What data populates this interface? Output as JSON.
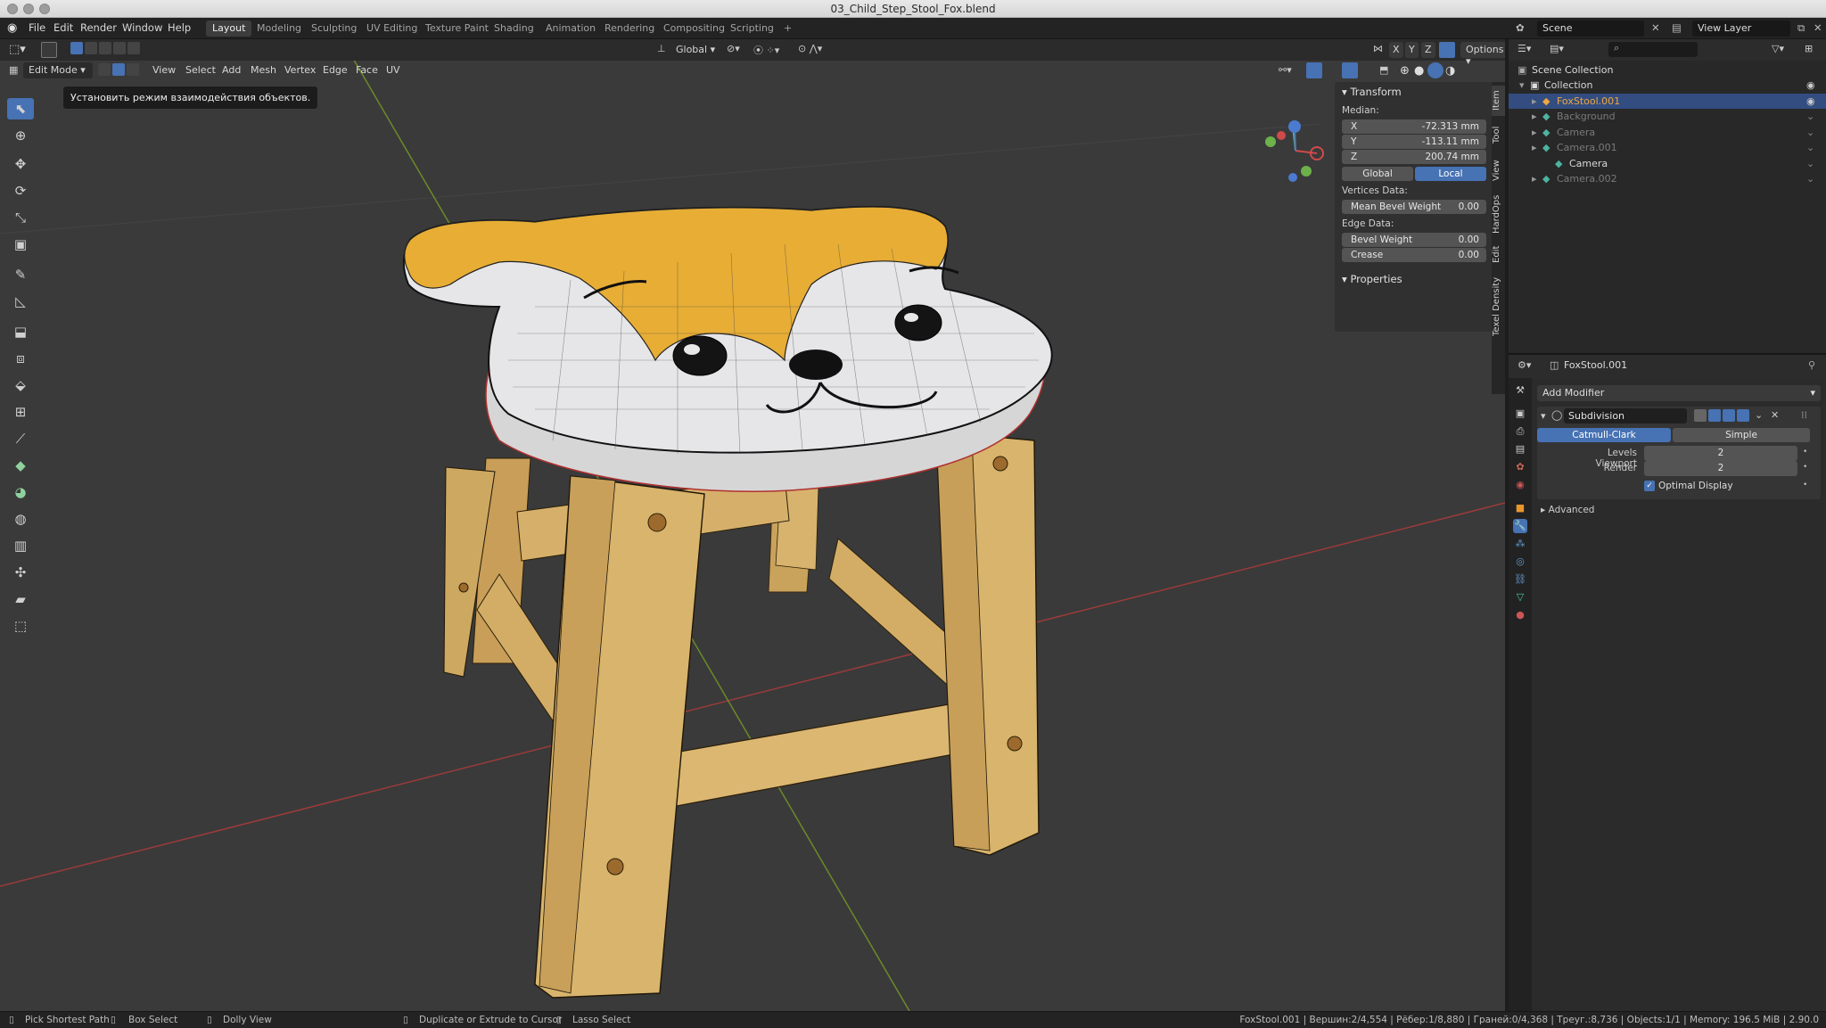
{
  "window": {
    "title": "03_Child_Step_Stool_Fox.blend"
  },
  "menu": [
    "File",
    "Edit",
    "Render",
    "Window",
    "Help"
  ],
  "workspaces": [
    "Layout",
    "Modeling",
    "Sculpting",
    "UV Editing",
    "Texture Paint",
    "Shading",
    "Animation",
    "Rendering",
    "Compositing",
    "Scripting"
  ],
  "active_workspace": "Layout",
  "scene": {
    "name": "Scene",
    "view_layer": "View Layer"
  },
  "viewport": {
    "mode": "Edit Mode",
    "menus": [
      "View",
      "Select",
      "Add",
      "Mesh",
      "Vertex",
      "Edge",
      "Face",
      "UV"
    ],
    "orientation": "Global",
    "options_label": "Options",
    "axis_buttons": [
      "X",
      "Y",
      "Z"
    ],
    "tooltip": "Установить режим взаимодействия объектов.",
    "gizmo": {
      "x": "X",
      "y": "Y",
      "z": "Z"
    }
  },
  "npanel": {
    "transform_title": "Transform",
    "median_label": "Median:",
    "x": {
      "label": "X",
      "value": "-72.313 mm"
    },
    "y": {
      "label": "Y",
      "value": "-113.11 mm"
    },
    "z": {
      "label": "Z",
      "value": "200.74 mm"
    },
    "global": "Global",
    "local": "Local",
    "vertices_data": "Vertices Data:",
    "mean_bevel": {
      "label": "Mean Bevel Weight",
      "value": "0.00"
    },
    "edge_data": "Edge Data:",
    "bevel_weight": {
      "label": "Bevel Weight",
      "value": "0.00"
    },
    "crease": {
      "label": "Crease",
      "value": "0.00"
    },
    "properties_title": "Properties",
    "tabs": [
      "Item",
      "Tool",
      "View",
      "HardOps",
      "Edit",
      "Texel Density"
    ]
  },
  "outliner": {
    "root": "Scene Collection",
    "items": [
      {
        "label": "Collection",
        "indent": 1,
        "color": "#d8d8d8"
      },
      {
        "label": "FoxStool.001",
        "indent": 2,
        "color": "#f0a640",
        "selected": true
      },
      {
        "label": "Background",
        "indent": 2,
        "color": "#7a7a7a"
      },
      {
        "label": "Camera",
        "indent": 2,
        "color": "#7a7a7a"
      },
      {
        "label": "Camera.001",
        "indent": 2,
        "color": "#7a7a7a"
      },
      {
        "label": "Camera",
        "indent": 3,
        "color": "#d8d8d8"
      },
      {
        "label": "Camera.002",
        "indent": 2,
        "color": "#7a7a7a"
      }
    ]
  },
  "properties": {
    "object_name": "FoxStool.001",
    "add_modifier": "Add Modifier",
    "modifier_name": "Subdivision",
    "catmull": "Catmull-Clark",
    "simple": "Simple",
    "levels_viewport": {
      "label": "Levels Viewport",
      "value": "2"
    },
    "render": {
      "label": "Render",
      "value": "2"
    },
    "optimal_display": "Optimal Display",
    "advanced": "Advanced"
  },
  "statusbar": {
    "pick_shortest_path": "Pick Shortest Path",
    "box_select": "Box Select",
    "dolly_view": "Dolly View",
    "duplicate": "Duplicate or Extrude to Cursor",
    "lasso": "Lasso Select",
    "stats": "FoxStool.001 | Вершин:2/4,554 | Рёбер:1/8,880 | Граней:0/4,368 | Треуг.:8,736 | Objects:1/1 | Memory: 196.5 MiB | 2.90.0"
  },
  "colors": {
    "accent": "#4772b3",
    "selected_object": "#f0a640",
    "viewport_bg": "#3a3a3a"
  }
}
